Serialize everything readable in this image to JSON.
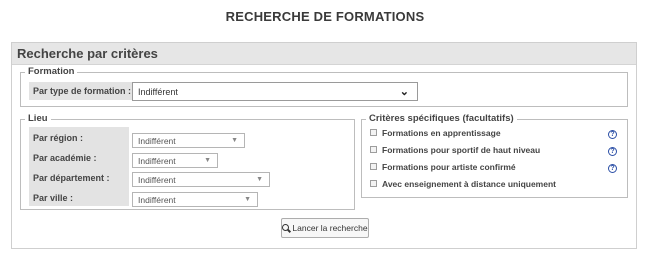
{
  "page": {
    "title": "RECHERCHE DE FORMATIONS"
  },
  "panel": {
    "title": "Recherche par critères"
  },
  "formation": {
    "legend": "Formation",
    "type_label": "Par type de formation :",
    "type_value": "Indifférent"
  },
  "lieu": {
    "legend": "Lieu",
    "fields": [
      {
        "label": "Par région :",
        "value": "Indifférent"
      },
      {
        "label": "Par académie :",
        "value": "Indifférent"
      },
      {
        "label": "Par département :",
        "value": "Indifférent"
      },
      {
        "label": "Par ville :",
        "value": "Indifférent"
      }
    ]
  },
  "criteres": {
    "legend": "Critères spécifiques (facultatifs)",
    "items": [
      {
        "label": "Formations en apprentissage",
        "checked": false,
        "help": true
      },
      {
        "label": "Formations pour sportif de haut niveau",
        "checked": false,
        "help": true
      },
      {
        "label": "Formations pour artiste confirmé",
        "checked": false,
        "help": true
      },
      {
        "label": "Avec enseignement à distance uniquement",
        "checked": false,
        "help": false
      }
    ],
    "help_symbol": "?"
  },
  "search_button": {
    "label": "Lancer la recherche",
    "icon": "magnifier-icon"
  }
}
